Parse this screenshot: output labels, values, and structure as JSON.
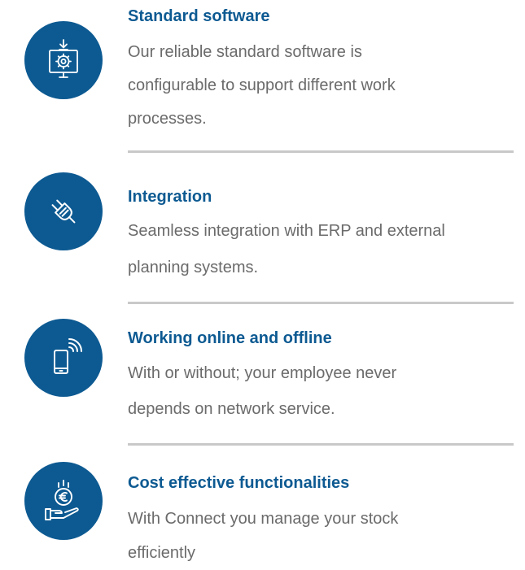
{
  "colors": {
    "accent": "#0d5a92",
    "text": "#6b6b6b",
    "divider": "#c9c9c9"
  },
  "features": [
    {
      "icon": "monitor-gear-icon",
      "title": "Standard software",
      "lines": [
        "Our reliable standard software is",
        "configurable to support different work",
        "processes."
      ]
    },
    {
      "icon": "plug-icon",
      "title": "Integration",
      "lines": [
        "Seamless integration with ERP and external",
        "planning systems."
      ]
    },
    {
      "icon": "smartphone-signal-icon",
      "title": "Working online and offline",
      "lines": [
        "With or without; your employee never",
        "depends on network service."
      ]
    },
    {
      "icon": "hand-euro-coin-icon",
      "title": "Cost effective functionalities",
      "lines": [
        "With Connect you manage your stock",
        "efficiently"
      ]
    }
  ]
}
